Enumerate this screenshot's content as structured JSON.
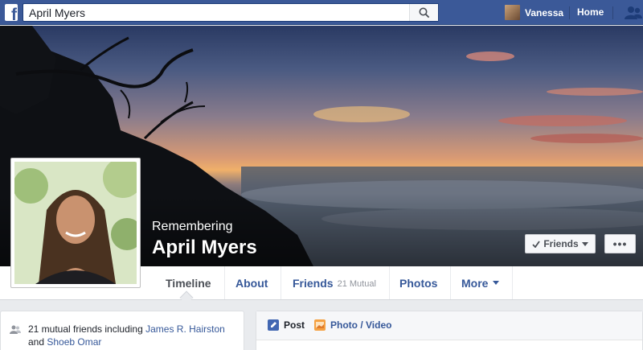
{
  "topbar": {
    "logo_letter": "f",
    "search_value": "April Myers",
    "user_name": "Vanessa",
    "home_label": "Home"
  },
  "profile": {
    "remembering_label": "Remembering",
    "name": "April Myers",
    "friends_button": "Friends",
    "more_button": "•••"
  },
  "tabs": [
    {
      "label": "Timeline",
      "active": true
    },
    {
      "label": "About"
    },
    {
      "label": "Friends",
      "count": "21 Mutual"
    },
    {
      "label": "Photos"
    },
    {
      "label": "More"
    }
  ],
  "mutual": {
    "prefix": "21 mutual friends including",
    "friend1": "James R. Hairston",
    "connector": "and",
    "friend2": "Shoeb Omar"
  },
  "composer": {
    "post_label": "Post",
    "photo_label": "Photo / Video"
  },
  "colors": {
    "brand": "#3b5998",
    "link": "#365899",
    "background": "#e9ebee"
  }
}
